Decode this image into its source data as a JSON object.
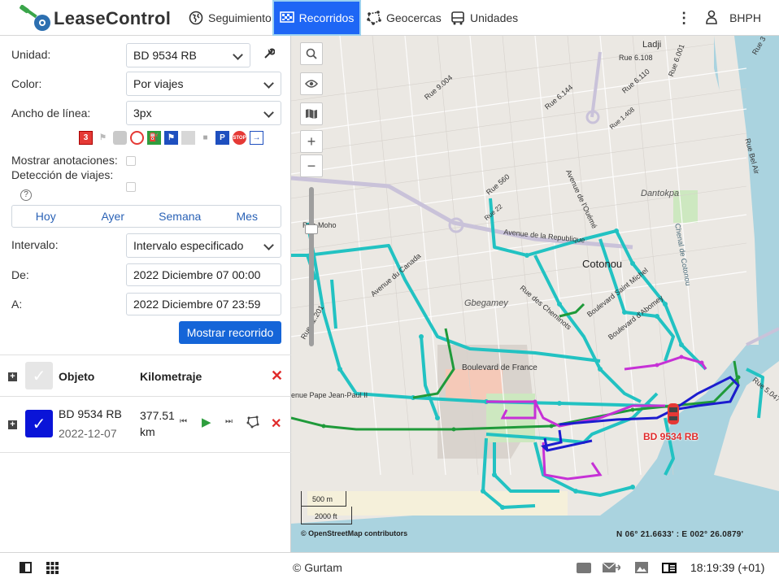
{
  "app": {
    "brand": "LeaseControl"
  },
  "nav": {
    "tracking": "Seguimiento",
    "routes": "Recorridos",
    "geofences": "Geocercas",
    "units": "Unidades",
    "user": "BHPH"
  },
  "form": {
    "unit_label": "Unidad:",
    "unit_value": "BD 9534 RB",
    "color_label": "Color:",
    "color_value": "Por viajes",
    "width_label": "Ancho de línea:",
    "width_value": "3px",
    "show_annotations": "Mostrar anotaciones:",
    "trip_detection": "Detección de viajes:",
    "interval_label": "Intervalo:",
    "interval_value": "Intervalo especificado",
    "from_label": "De:",
    "from_value": "2022 Diciembre 07 00:00",
    "to_label": "A:",
    "to_value": "2022 Diciembre 07 23:59",
    "submit": "Mostrar recorrido",
    "marker_count": "3"
  },
  "periods": [
    "Hoy",
    "Ayer",
    "Semana",
    "Mes"
  ],
  "table": {
    "col_object": "Objeto",
    "col_mileage": "Kilometraje",
    "rows": [
      {
        "name": "BD 9534 RB",
        "date": "2022-12-07",
        "mileage": "377.51",
        "unit": "km"
      }
    ]
  },
  "map": {
    "labels": {
      "ladji": "Ladji",
      "cotonou": "Cotonou",
      "dantokpa": "Dantokpa",
      "gbegamey": "Gbegamey",
      "chenal": "Chenal de Cotonou",
      "bd_france": "Boulevard de France",
      "av_jean_paul": "enue Pape Jean-Paul II",
      "av_clozel": "Avenue du Canada",
      "av_republique": "Avenue de la Republique",
      "bd_saint_michel": "Boulevard Saint Michel",
      "bd_abomey": "Boulevard d'Abomey",
      "av_ouemé": "Avenue de l'Ouémé",
      "rue_560": "Rue 560",
      "rue_6108": "Rue 6.108",
      "rue_6001": "Rue 6.001",
      "rue_6110": "Rue 6.110",
      "rue_6144": "Rue 6.144",
      "rue_9004": "Rue 9.004",
      "rue_12201": "Rue 12.201",
      "rue_5047": "Rue 5.047",
      "rue_3": "Rue 3",
      "rue_bel": "Rue Bel Air",
      "rue_des_cheminots": "Rue des Cheminots",
      "rue_22": "Rue 22",
      "rue_moho": "Rue Moho",
      "rue_1408": "Rue 1.408"
    },
    "vehicle_label": "BD 9534 RB",
    "scale_m": "500 m",
    "scale_ft": "2000 ft",
    "attribution": "© OpenStreetMap contributors",
    "coordinates": "N 06° 21.6633' : E 002° 26.0879'"
  },
  "footer": {
    "copyright": "© Gurtam",
    "time": "18:19:39 (+01)"
  },
  "colors": {
    "accent": "#1e66f5",
    "track_cyan": "#22c2c2",
    "track_green": "#1f9a3a",
    "track_magenta": "#c631d6",
    "track_blue": "#1c1ccf",
    "water": "#aad3df"
  }
}
